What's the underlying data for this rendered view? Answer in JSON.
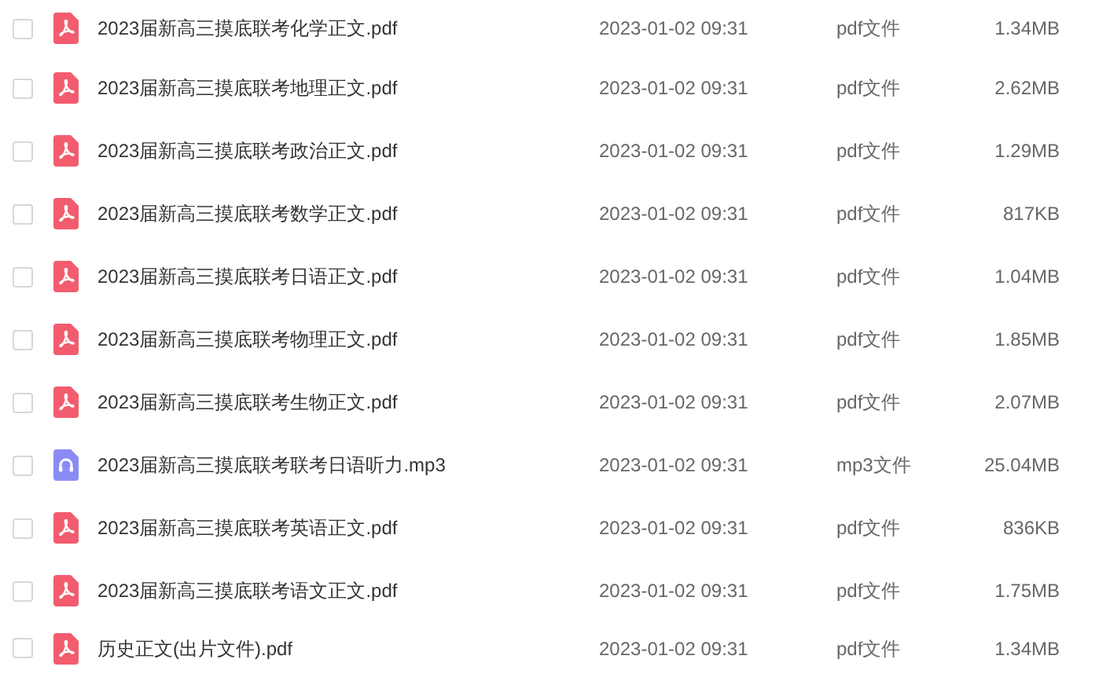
{
  "files": [
    {
      "kind": "pdf",
      "checked": false,
      "name": "2023届新高三摸底联考化学正文.pdf",
      "modified": "2023-01-02 09:31",
      "type": "pdf文件",
      "size": "1.34MB"
    },
    {
      "kind": "pdf",
      "checked": false,
      "name": "2023届新高三摸底联考地理正文.pdf",
      "modified": "2023-01-02 09:31",
      "type": "pdf文件",
      "size": "2.62MB"
    },
    {
      "kind": "pdf",
      "checked": false,
      "name": "2023届新高三摸底联考政治正文.pdf",
      "modified": "2023-01-02 09:31",
      "type": "pdf文件",
      "size": "1.29MB"
    },
    {
      "kind": "pdf",
      "checked": false,
      "name": "2023届新高三摸底联考数学正文.pdf",
      "modified": "2023-01-02 09:31",
      "type": "pdf文件",
      "size": "817KB"
    },
    {
      "kind": "pdf",
      "checked": false,
      "name": "2023届新高三摸底联考日语正文.pdf",
      "modified": "2023-01-02 09:31",
      "type": "pdf文件",
      "size": "1.04MB"
    },
    {
      "kind": "pdf",
      "checked": false,
      "name": "2023届新高三摸底联考物理正文.pdf",
      "modified": "2023-01-02 09:31",
      "type": "pdf文件",
      "size": "1.85MB"
    },
    {
      "kind": "pdf",
      "checked": false,
      "name": "2023届新高三摸底联考生物正文.pdf",
      "modified": "2023-01-02 09:31",
      "type": "pdf文件",
      "size": "2.07MB"
    },
    {
      "kind": "audio",
      "checked": false,
      "name": "2023届新高三摸底联考联考日语听力.mp3",
      "modified": "2023-01-02 09:31",
      "type": "mp3文件",
      "size": "25.04MB"
    },
    {
      "kind": "pdf",
      "checked": false,
      "name": "2023届新高三摸底联考英语正文.pdf",
      "modified": "2023-01-02 09:31",
      "type": "pdf文件",
      "size": "836KB"
    },
    {
      "kind": "pdf",
      "checked": false,
      "name": "2023届新高三摸底联考语文正文.pdf",
      "modified": "2023-01-02 09:31",
      "type": "pdf文件",
      "size": "1.75MB"
    },
    {
      "kind": "pdf",
      "checked": false,
      "name": "历史正文(出片文件).pdf",
      "modified": "2023-01-02 09:31",
      "type": "pdf文件",
      "size": "1.34MB"
    }
  ]
}
